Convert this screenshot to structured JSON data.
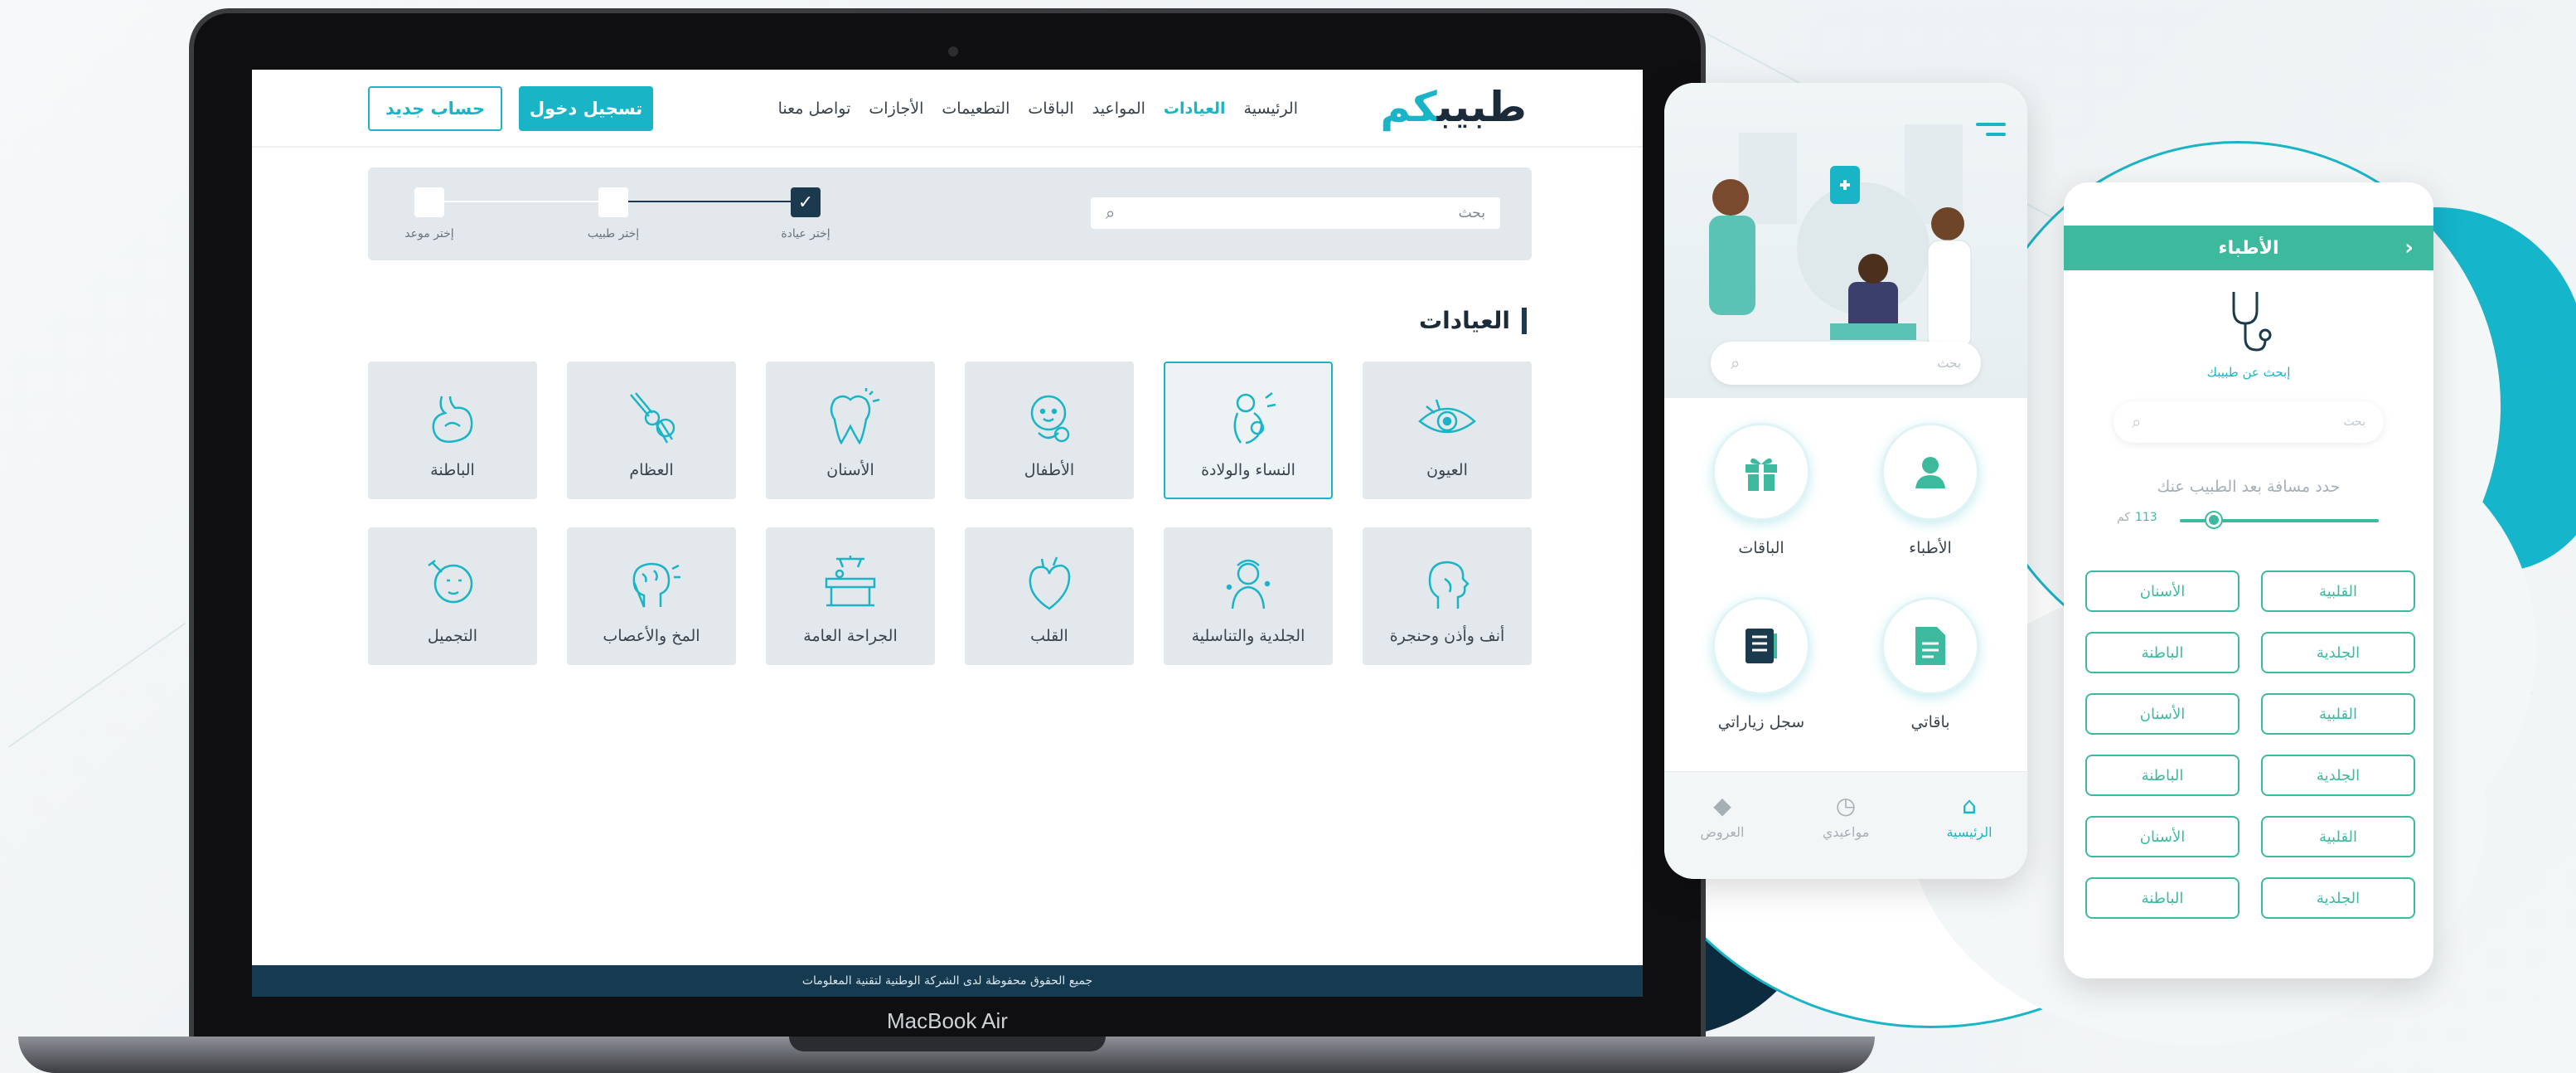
{
  "colors": {
    "accent": "#1ab4c7",
    "dark": "#163a50",
    "green": "#3dba9e"
  },
  "laptop": {
    "model_label": "MacBook Air",
    "header": {
      "logo": {
        "part1": "طبيب",
        "part2": "كم"
      },
      "nav": [
        {
          "label": "الرئيسية",
          "active": false
        },
        {
          "label": "العيادات",
          "active": true
        },
        {
          "label": "المواعيد",
          "active": false
        },
        {
          "label": "الباقات",
          "active": false
        },
        {
          "label": "التطعيمات",
          "active": false
        },
        {
          "label": "الأجازات",
          "active": false
        },
        {
          "label": "تواصل معنا",
          "active": false
        }
      ],
      "login_label": "تسجيل دخول",
      "signup_label": "حساب جديد"
    },
    "steps": {
      "search_placeholder": "بحث",
      "items": [
        {
          "label": "إختر عيادة",
          "done": true
        },
        {
          "label": "إختر طبيب",
          "done": false
        },
        {
          "label": "إختر موعد",
          "done": false
        }
      ]
    },
    "section_title": "العيادات",
    "clinics": [
      {
        "label": "العيون",
        "icon": "eye-icon",
        "selected": false
      },
      {
        "label": "النساء والولادة",
        "icon": "pregnancy-icon",
        "selected": true
      },
      {
        "label": "الأطفال",
        "icon": "baby-icon",
        "selected": false
      },
      {
        "label": "الأسنان",
        "icon": "tooth-icon",
        "selected": false
      },
      {
        "label": "العظام",
        "icon": "bone-joint-icon",
        "selected": false
      },
      {
        "label": "الباطنة",
        "icon": "stomach-icon",
        "selected": false
      },
      {
        "label": "أنف وأذن وحنجرة",
        "icon": "ent-head-icon",
        "selected": false
      },
      {
        "label": "الجلدية والتناسلية",
        "icon": "skin-icon",
        "selected": false
      },
      {
        "label": "القلب",
        "icon": "heart-icon",
        "selected": false
      },
      {
        "label": "الجراحة العامة",
        "icon": "surgery-table-icon",
        "selected": false
      },
      {
        "label": "المخ والأعصاب",
        "icon": "brain-icon",
        "selected": false
      },
      {
        "label": "التجميل",
        "icon": "cosmetic-face-icon",
        "selected": false
      }
    ],
    "footer": "جميع الحقوق محفوظة لدى الشركة الوطنية لتقنية المعلومات"
  },
  "phone_home": {
    "search_placeholder": "بحث",
    "tiles": [
      {
        "label": "الأطباء",
        "icon": "user-icon"
      },
      {
        "label": "الباقات",
        "icon": "gift-icon"
      },
      {
        "label": "باقاتي",
        "icon": "document-icon"
      },
      {
        "label": "سجل زياراتي",
        "icon": "record-book-icon"
      }
    ],
    "tabs": [
      {
        "label": "الرئيسية",
        "icon": "home-icon",
        "active": true
      },
      {
        "label": "مواعيدي",
        "icon": "clock-icon",
        "active": false
      },
      {
        "label": "العروض",
        "icon": "tag-icon",
        "active": false
      }
    ]
  },
  "phone_doctors": {
    "title": "الأطباء",
    "subtitle": "إبحث عن طبيبك",
    "search_placeholder": "بحث",
    "distance_label": "حدد مسافة بعد الطبيب عنك",
    "distance_value": "113",
    "distance_unit": "كم",
    "distance_fraction": 0.17,
    "chips": [
      "القلبية",
      "الأسنان",
      "الجلدية",
      "الباطنة",
      "القلبية",
      "الأسنان",
      "الجلدية",
      "الباطنة",
      "القلبية",
      "الأسنان",
      "الجلدية",
      "الباطنة"
    ]
  }
}
